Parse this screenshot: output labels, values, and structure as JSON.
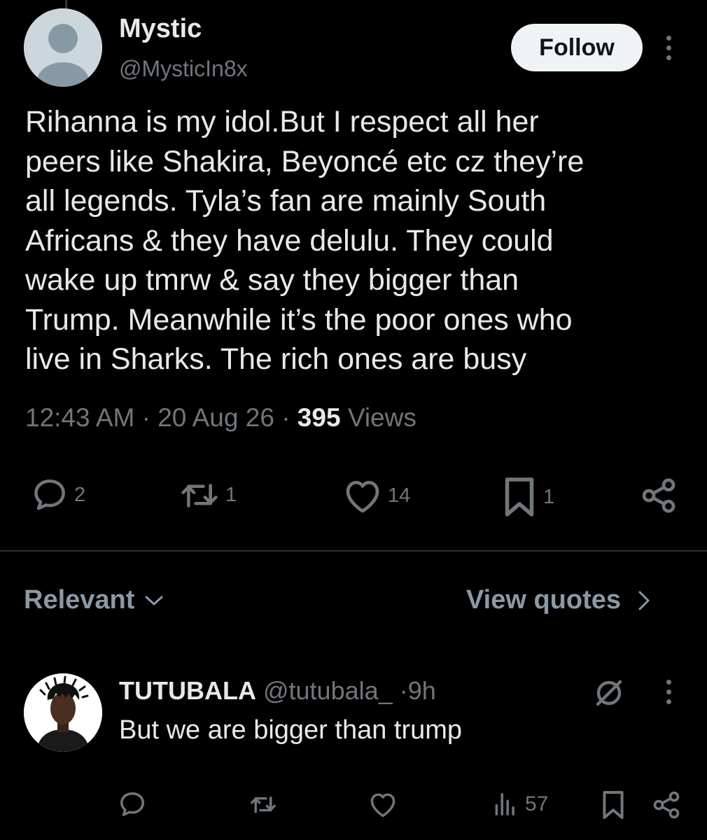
{
  "post": {
    "author_name": "Mystic",
    "author_handle": "@MysticIn8x",
    "follow_label": "Follow",
    "text": "Rihanna is my idol.But I respect all her\npeers like Shakira, Beyoncé etc cz they’re\nall legends. Tyla’s fan are mainly South\nAfricans & they have delulu. They could\nwake up tmrw & say they bigger than\nTrump. Meanwhile it’s the poor ones who\nlive in Sharks. The rich ones are busy",
    "time": "12:43 AM",
    "date": "20 Aug 26",
    "views_count": "395",
    "views_label": "Views",
    "separator": "·",
    "actions": {
      "replies": "2",
      "reposts": "1",
      "likes": "14",
      "bookmarks": "1"
    }
  },
  "replies_section": {
    "sort_label": "Relevant",
    "view_quotes_label": "View quotes"
  },
  "reply": {
    "name": "TUTUBALA",
    "handle": "@tutubala_",
    "separator": "·",
    "time": "9h",
    "text": "But we are bigger than trump",
    "views": "57"
  },
  "icons": [
    "default-avatar-icon",
    "more-icon",
    "reply-icon",
    "repost-icon",
    "like-icon",
    "bookmark-icon",
    "share-icon",
    "chevron-down-icon",
    "chevron-right-icon",
    "grok-icon",
    "views-icon"
  ],
  "colors": {
    "background": "#000000",
    "primary_text": "#e7e9ea",
    "secondary_text": "#71767b",
    "follow_button_bg": "#eff3f4"
  }
}
